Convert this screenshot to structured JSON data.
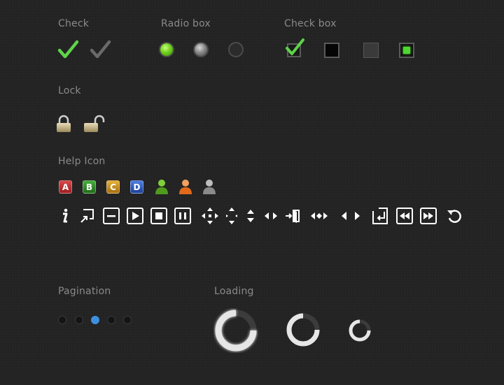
{
  "sections": {
    "check": "Check",
    "radio": "Radio box",
    "checkbox": "Check box",
    "lock": "Lock",
    "help": "Help Icon",
    "pagination": "Pagination",
    "loading": "Loading"
  },
  "help_letters": [
    "A",
    "B",
    "C",
    "D"
  ],
  "pagination": {
    "pages": 5,
    "active_index": 2
  },
  "colors": {
    "background": "#232323",
    "label": "#8a8a8a",
    "check_green": "#5fd34a",
    "radio_green": "#6fd11c",
    "pagination_active": "#3d8fe0",
    "letter_a": "#b5282a",
    "letter_b": "#2e8a25",
    "letter_c": "#c8901a",
    "letter_d": "#2f5cc0"
  },
  "icons": {
    "toolbar": [
      "info-icon",
      "external-link-icon",
      "minimize-icon",
      "play-icon",
      "stop-icon",
      "pause-icon",
      "move-icon",
      "vertical-resize-icon",
      "up-down-arrows-icon",
      "left-right-arrows-icon",
      "enter-door-icon",
      "horizontal-resize-icon",
      "prev-next-icon",
      "return-icon",
      "rewind-icon",
      "fast-forward-icon",
      "refresh-icon"
    ]
  }
}
